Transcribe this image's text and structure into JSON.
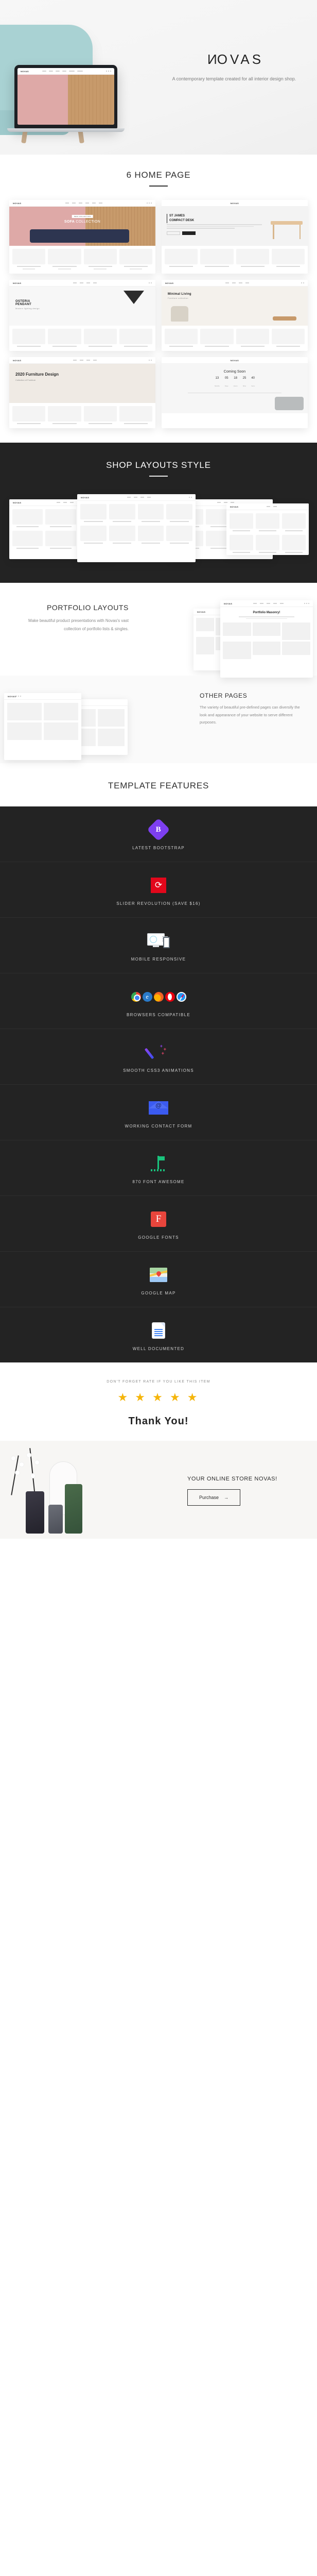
{
  "hero": {
    "brand": "NOVAS",
    "tagline": "A contemporary template created for all interior design shop."
  },
  "home_section": {
    "title": "6 HOME PAGE",
    "cards": [
      {
        "badge": "NEW COLLECTION",
        "title_strong": "SOFA",
        "title_light": " COLLECTION",
        "index": "01"
      },
      {
        "title": "ST JAMES",
        "title2": "COMPACT DESK",
        "btn1": "VIEW DETAILS",
        "btn2": "SHOP NOW"
      },
      {
        "title": "OSTERIA",
        "title2": "PENDANT",
        "sub": "Modern lighting design"
      },
      {
        "title": "Minimal Living",
        "sub": "Furniture collection"
      },
      {
        "title": "2020 Furniture Design",
        "sub": "Collection of Furniture"
      },
      {
        "title": "Coming Soon",
        "counter": [
          {
            "value": "13",
            "label": "Months"
          },
          {
            "value": "05",
            "label": "Days"
          },
          {
            "value": "18",
            "label": "Hours"
          },
          {
            "value": "25",
            "label": "Mins"
          },
          {
            "value": "40",
            "label": "Secs"
          }
        ],
        "field_placeholder": "Your Email Address",
        "field_button": "Subscribe"
      }
    ]
  },
  "shop_section": {
    "title": "SHOP LAYOUTS STYLE"
  },
  "portfolio_section": {
    "title": "PORTFOLIO LAYOUTS",
    "body": "Make beautiful product presentations with Novas's vast collection of portfolio lists & singles.",
    "preview_title": "Portfolio Masonry!"
  },
  "other_section": {
    "title": "OTHER PAGES",
    "body": "The variety of beautiful pre-defined pages can diversify the look and appearance of your website to serve different purposes."
  },
  "features_section": {
    "title": "TEMPLATE FEATURES",
    "items": [
      {
        "icon": "bootstrap-icon",
        "label": "LATEST BOOTSTRAP"
      },
      {
        "icon": "slider-revolution-icon",
        "label": "SLIDER REVOLUTION (SAVE $16)"
      },
      {
        "icon": "mobile-responsive-icon",
        "label": "MOBILE RESPONSIVE"
      },
      {
        "icon": "browsers-icon",
        "label": "BROWSERS COMPATIBLE"
      },
      {
        "icon": "magic-wand-icon",
        "label": "SMOOTH CSS3 ANIMATIONS"
      },
      {
        "icon": "envelope-icon",
        "label": "WORKING CONTACT FORM"
      },
      {
        "icon": "font-awesome-icon",
        "label": "870 FONT AWESOME"
      },
      {
        "icon": "google-fonts-icon",
        "label": "GOOGLE FONTS"
      },
      {
        "icon": "google-map-icon",
        "label": "GOOGLE MAP"
      },
      {
        "icon": "document-icon",
        "label": "WELL DOCUMENTED"
      }
    ]
  },
  "rating_section": {
    "prompt": "DON'T FORGET RATE IF YOU LIKE THIS ITEM",
    "stars": "★ ★ ★ ★ ★",
    "thanks": "Thank You!"
  },
  "footer": {
    "title": "YOUR ONLINE STORE NOVAS!",
    "button": "Purchase",
    "arrow": "→"
  },
  "colors": {
    "dark_bg": "#232323",
    "accent_star": "#f5b50a",
    "bootstrap_purple": "#7d3ff0",
    "slider_red": "#e2071b"
  }
}
